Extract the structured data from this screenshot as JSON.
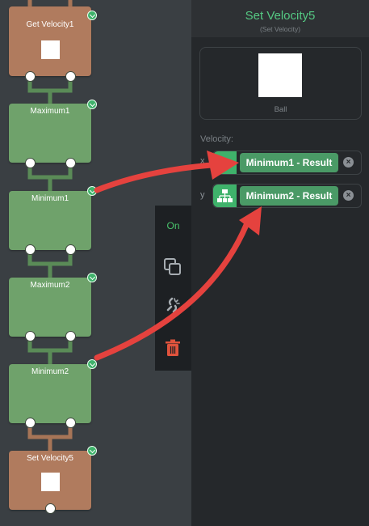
{
  "canvas": {
    "nodes": [
      {
        "label": "Get Velocity1",
        "kind": "brown"
      },
      {
        "label": "Maximum1",
        "kind": "green"
      },
      {
        "label": "Minimum1",
        "kind": "green"
      },
      {
        "label": "Maximum2",
        "kind": "green"
      },
      {
        "label": "Minimum2",
        "kind": "green"
      },
      {
        "label": "Set Velocity5",
        "kind": "brown"
      }
    ]
  },
  "toolbar": {
    "on_label": "On",
    "icons": [
      "copy-icon",
      "disconnect-icon",
      "trash-icon"
    ]
  },
  "inspector": {
    "title": "Set Velocity5",
    "subtitle": "(Set Velocity)",
    "object_label": "Ball",
    "field_label": "Velocity:",
    "rows": [
      {
        "axis": "x",
        "value": "Minimum1 - Result"
      },
      {
        "axis": "y",
        "value": "Minimum2 - Result"
      }
    ]
  },
  "colors": {
    "accent_green": "#55c983",
    "node_green": "#6fa26b",
    "node_brown": "#b07b5e",
    "arrow_red": "#e5423e",
    "trash_red": "#e0533d"
  }
}
